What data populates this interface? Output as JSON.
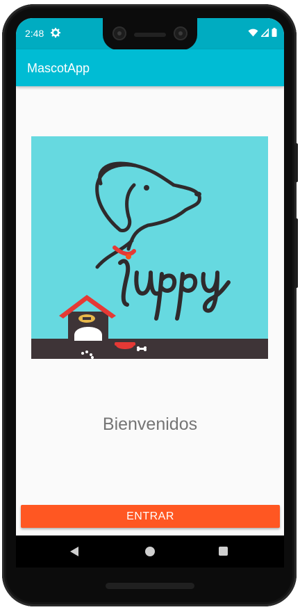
{
  "status_bar": {
    "time": "2:48",
    "icons": [
      "gear-icon",
      "wifi-icon",
      "signal-icon",
      "battery-icon"
    ],
    "color": "#00acc1"
  },
  "app_bar": {
    "title": "MascotApp",
    "color": "#00bcd4"
  },
  "hero": {
    "logo_text": "Puppy",
    "background": "#66d9e0"
  },
  "main": {
    "welcome": "Bienvenidos"
  },
  "enter_button": {
    "label": "ENTRAR",
    "color": "#ff5722"
  },
  "nav_bar": {
    "icons": [
      "back-icon",
      "home-icon",
      "recents-icon"
    ]
  }
}
